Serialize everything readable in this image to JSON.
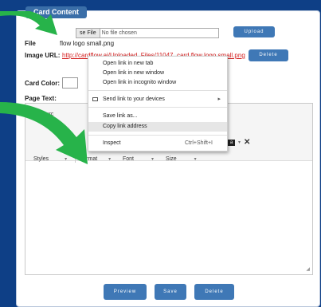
{
  "panel": {
    "legend": "Card Content"
  },
  "file": {
    "button_label": "se File",
    "status": "No file chosen",
    "upload_label": "Upload",
    "label": "File",
    "filename": "flow logo small.png"
  },
  "image_url": {
    "label": "Image URL:",
    "url": "http://cardflow.ai/Uploaded_Files/11047_card flow logo small.png",
    "delete_label": "Delete"
  },
  "card_color": {
    "label": "Card Color:"
  },
  "page_text": {
    "label": "Page Text:"
  },
  "editor": {
    "source_label": "Sourc",
    "styles_label": "Styles",
    "format_label": "Format",
    "font_label": "Font",
    "size_label": "Size"
  },
  "context_menu": {
    "items": [
      {
        "label": "Open link in new tab"
      },
      {
        "label": "Open link in new window"
      },
      {
        "label": "Open link in incognito window"
      },
      {
        "label": "Send link to your devices"
      },
      {
        "label": "Save link as..."
      },
      {
        "label": "Copy link address"
      },
      {
        "label": "Inspect",
        "shortcut": "Ctrl+Shift+I"
      }
    ]
  },
  "actions": {
    "preview_label": "Preview",
    "save_label": "Save",
    "delete_label": "Delete"
  },
  "colors": {
    "background": "#0e3f86",
    "accent": "#3f78b6",
    "link": "#d42020",
    "arrow": "#27b34a"
  }
}
